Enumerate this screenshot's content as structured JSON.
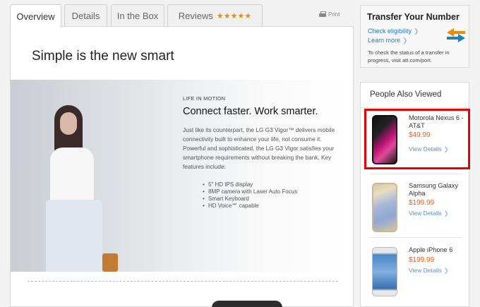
{
  "tabs": [
    {
      "label": "Overview",
      "active": true
    },
    {
      "label": "Details"
    },
    {
      "label": "In the Box"
    },
    {
      "label": "Reviews",
      "stars": "★★★★★"
    }
  ],
  "print_label": "Print",
  "main": {
    "title": "Simple is the new smart",
    "eyebrow": "LIFE IN MOTION",
    "hero_title": "Connect faster. Work smarter.",
    "hero_body": "Just like its counterpart, the LG G3 Vigor™ delivers mobile connectivity built to enhance your life, not consume it. Powerful and sophisticated, the LG G3 Vigor satisfies your smartphone requirements without breaking the bank. Key features include:",
    "features": [
      "5\" HD IPS display",
      "8MP camera with Laser Auto Focus",
      "Smart Keyboard",
      "HD Voice℠ capable"
    ]
  },
  "transfer": {
    "title": "Transfer Your Number",
    "check_link": "Check eligibility",
    "learn_link": "Learn more",
    "note": "To check the status of a transfer in progress, visit att.com/port."
  },
  "people_also_viewed": {
    "title": "People Also Viewed",
    "items": [
      {
        "name": "Motorola Nexus 6 - AT&T",
        "price": "$49.99",
        "link": "View Details"
      },
      {
        "name": "Samsung Galaxy Alpha",
        "price": "$199.99",
        "link": "View Details"
      },
      {
        "name": "Apple iPhone 6",
        "price": "$199.99",
        "link": "View Details"
      }
    ]
  },
  "colors": {
    "accent": "#f05a1a",
    "link": "#1e7fc1",
    "highlight": "#e60000",
    "stars": "#f08a00"
  }
}
